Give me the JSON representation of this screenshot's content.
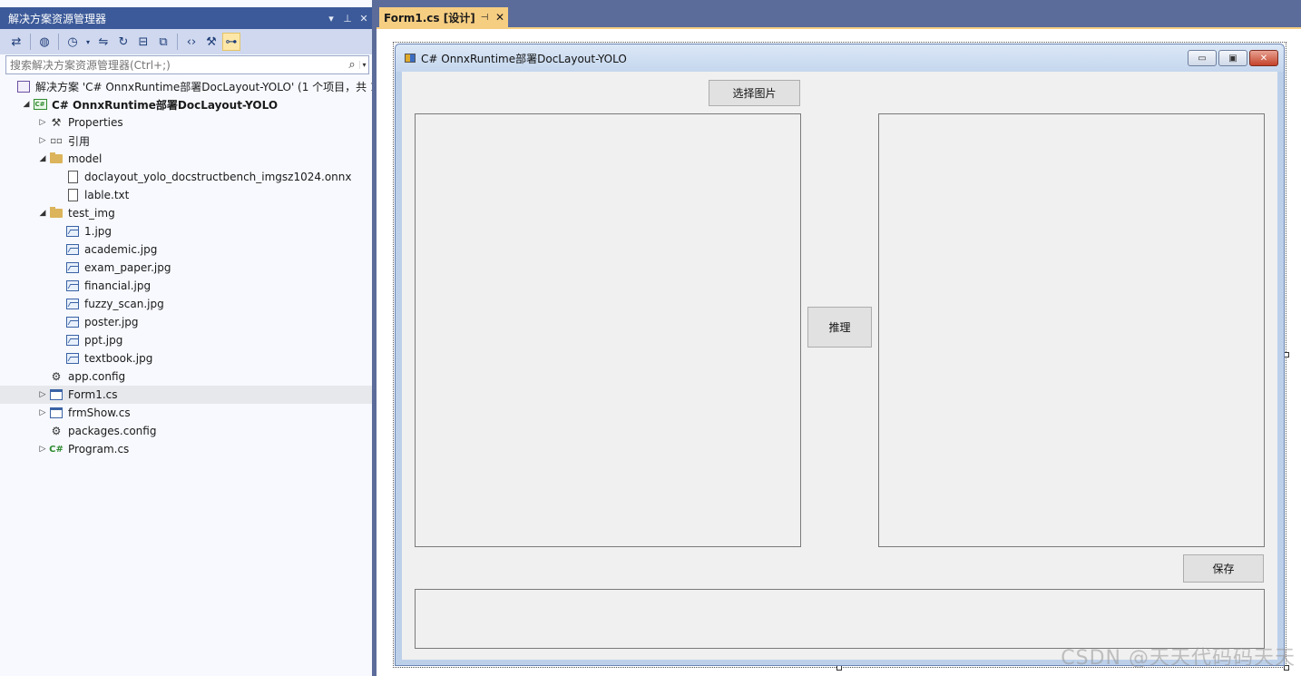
{
  "solution_explorer": {
    "title": "解决方案资源管理器",
    "title_controls": [
      "▾",
      "⊥",
      "✕"
    ],
    "search_placeholder": "搜索解决方案资源管理器(Ctrl+;)",
    "tree": [
      {
        "name": "solution",
        "label": "解决方案 'C# OnnxRuntime部署DocLayout-YOLO' (1 个项目，共 1",
        "icon": "solution-icon",
        "indent": 0,
        "arrow": "",
        "bold": false
      },
      {
        "name": "project",
        "label": "C# OnnxRuntime部署DocLayout-YOLO",
        "icon": "csharp-project-icon",
        "indent": 1,
        "arrow": "◢",
        "bold": true
      },
      {
        "name": "properties",
        "label": "Properties",
        "icon": "wrench-icon",
        "indent": 2,
        "arrow": "▷",
        "bold": false
      },
      {
        "name": "references",
        "label": "引用",
        "icon": "references-icon",
        "indent": 2,
        "arrow": "▷",
        "bold": false
      },
      {
        "name": "model",
        "label": "model",
        "icon": "folder-icon",
        "indent": 2,
        "arrow": "◢",
        "bold": false
      },
      {
        "name": "onnx-file",
        "label": "doclayout_yolo_docstructbench_imgsz1024.onnx",
        "icon": "file-icon",
        "indent": 3,
        "arrow": "",
        "bold": false
      },
      {
        "name": "lable-txt",
        "label": "lable.txt",
        "icon": "text-file-icon",
        "indent": 3,
        "arrow": "",
        "bold": false
      },
      {
        "name": "test-img",
        "label": "test_img",
        "icon": "folder-icon",
        "indent": 2,
        "arrow": "◢",
        "bold": false
      },
      {
        "name": "img-1",
        "label": "1.jpg",
        "icon": "image-file-icon",
        "indent": 3,
        "arrow": "",
        "bold": false
      },
      {
        "name": "img-academic",
        "label": "academic.jpg",
        "icon": "image-file-icon",
        "indent": 3,
        "arrow": "",
        "bold": false
      },
      {
        "name": "img-exam-paper",
        "label": "exam_paper.jpg",
        "icon": "image-file-icon",
        "indent": 3,
        "arrow": "",
        "bold": false
      },
      {
        "name": "img-financial",
        "label": "financial.jpg",
        "icon": "image-file-icon",
        "indent": 3,
        "arrow": "",
        "bold": false
      },
      {
        "name": "img-fuzzy-scan",
        "label": "fuzzy_scan.jpg",
        "icon": "image-file-icon",
        "indent": 3,
        "arrow": "",
        "bold": false
      },
      {
        "name": "img-poster",
        "label": "poster.jpg",
        "icon": "image-file-icon",
        "indent": 3,
        "arrow": "",
        "bold": false
      },
      {
        "name": "img-ppt",
        "label": "ppt.jpg",
        "icon": "image-file-icon",
        "indent": 3,
        "arrow": "",
        "bold": false
      },
      {
        "name": "img-textbook",
        "label": "textbook.jpg",
        "icon": "image-file-icon",
        "indent": 3,
        "arrow": "",
        "bold": false
      },
      {
        "name": "app-config",
        "label": "app.config",
        "icon": "config-file-icon",
        "indent": 2,
        "arrow": "",
        "bold": false
      },
      {
        "name": "form1-cs",
        "label": "Form1.cs",
        "icon": "form-file-icon",
        "indent": 2,
        "arrow": "▷",
        "bold": false,
        "selected": true
      },
      {
        "name": "frmshow-cs",
        "label": "frmShow.cs",
        "icon": "form-file-icon",
        "indent": 2,
        "arrow": "▷",
        "bold": false
      },
      {
        "name": "packages-config",
        "label": "packages.config",
        "icon": "config-file-icon",
        "indent": 2,
        "arrow": "",
        "bold": false
      },
      {
        "name": "program-cs",
        "label": "Program.cs",
        "icon": "csharp-file-icon",
        "indent": 2,
        "arrow": "▷",
        "bold": false
      }
    ]
  },
  "editor": {
    "tab_label": "Form1.cs [设计]",
    "tab_pin": "⊣",
    "tab_close": "✕"
  },
  "form": {
    "title": "C# OnnxRuntime部署DocLayout-YOLO",
    "select_image_button": "选择图片",
    "infer_button": "推理",
    "save_button": "保存",
    "window_buttons": {
      "minimize": "▭",
      "maximize": "▣",
      "close": "✕"
    }
  },
  "watermark": "CSDN @天天代码码天天",
  "colors": {
    "titlebar": "#3c5a99",
    "toolbar": "#cfd8ee",
    "tab_active": "#f6ce82",
    "form_client": "#f0f0f0",
    "frame": "#5c6c9a"
  }
}
